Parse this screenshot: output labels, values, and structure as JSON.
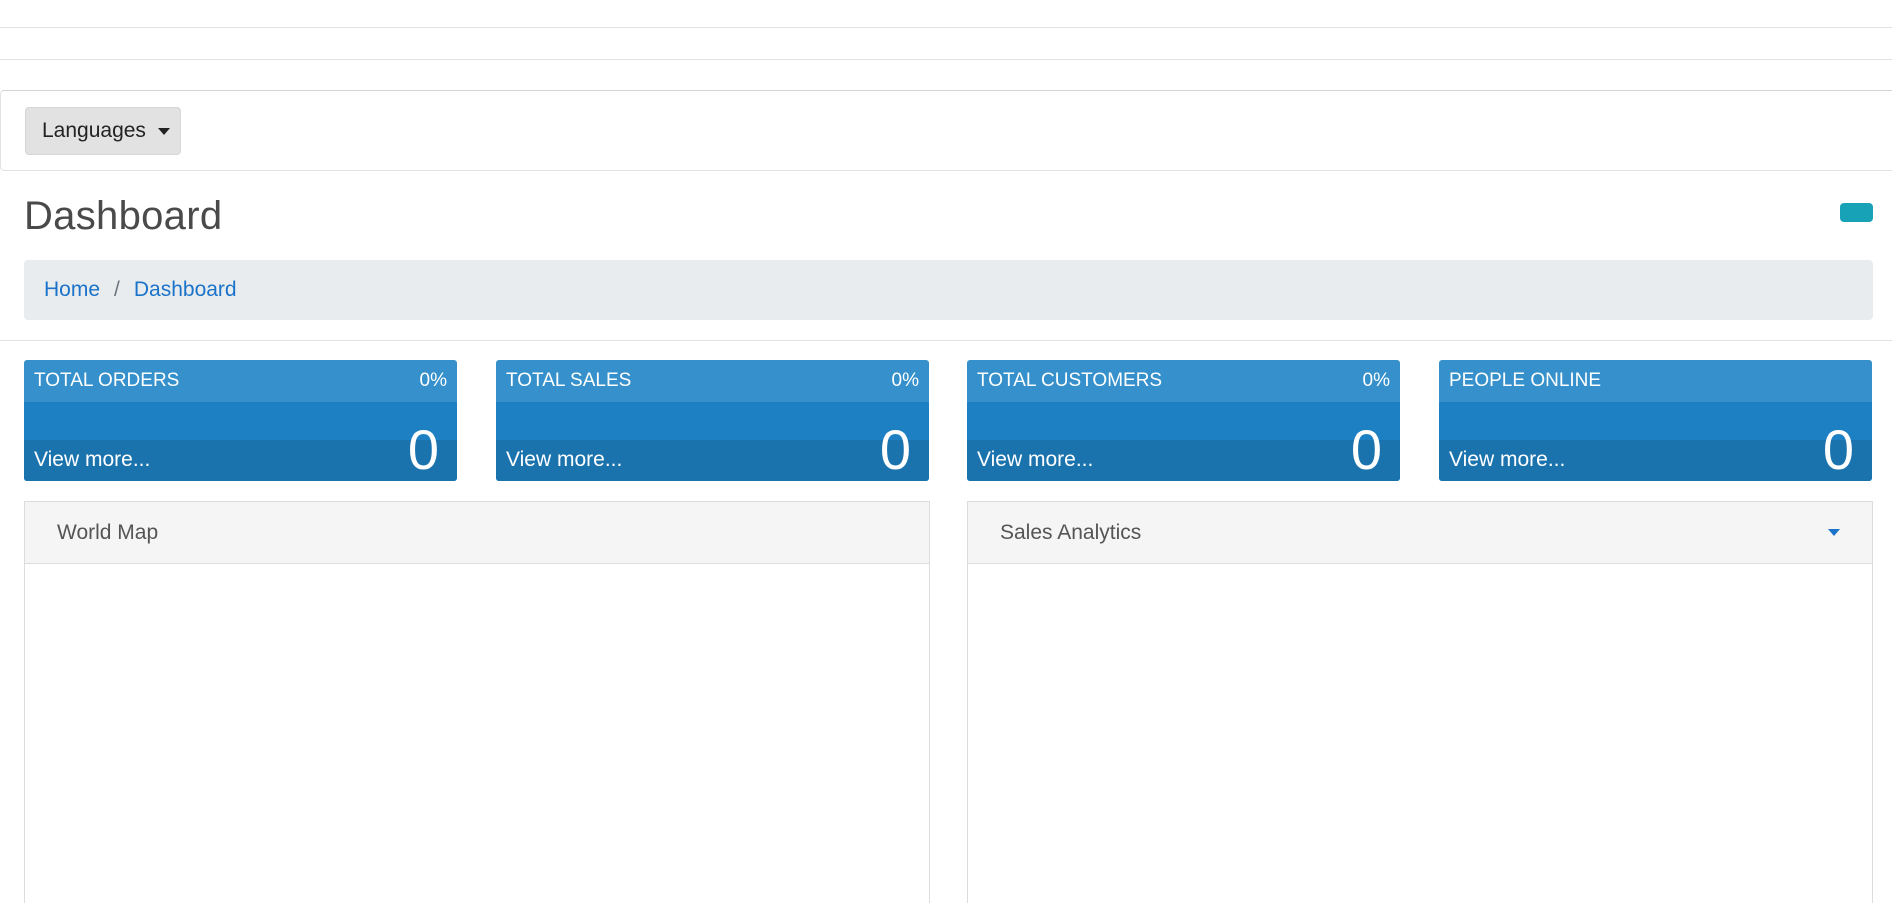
{
  "language_menu": {
    "label": "Languages"
  },
  "header": {
    "title": "Dashboard"
  },
  "breadcrumb": {
    "items": [
      {
        "label": "Home"
      },
      {
        "label": "Dashboard"
      }
    ],
    "separator": "/"
  },
  "stats": [
    {
      "title": "TOTAL ORDERS",
      "percent": "0%",
      "value": "0",
      "link": "View more..."
    },
    {
      "title": "TOTAL SALES",
      "percent": "0%",
      "value": "0",
      "link": "View more..."
    },
    {
      "title": "TOTAL CUSTOMERS",
      "percent": "0%",
      "value": "0",
      "link": "View more..."
    },
    {
      "title": "PEOPLE ONLINE",
      "percent": "",
      "value": "0",
      "link": "View more..."
    }
  ],
  "panels": {
    "world_map": {
      "title": "World Map"
    },
    "sales_analytics": {
      "title": "Sales Analytics"
    }
  },
  "colors": {
    "tile_header": "#3590cb",
    "tile_body": "#1d80c3",
    "tile_footer": "#1b73ae",
    "link": "#1a73c9",
    "info_button": "#17a2b8"
  },
  "icons": {
    "language_dropdown": "caret-down-icon",
    "sales_analytics_toggle": "caret-down-icon"
  }
}
